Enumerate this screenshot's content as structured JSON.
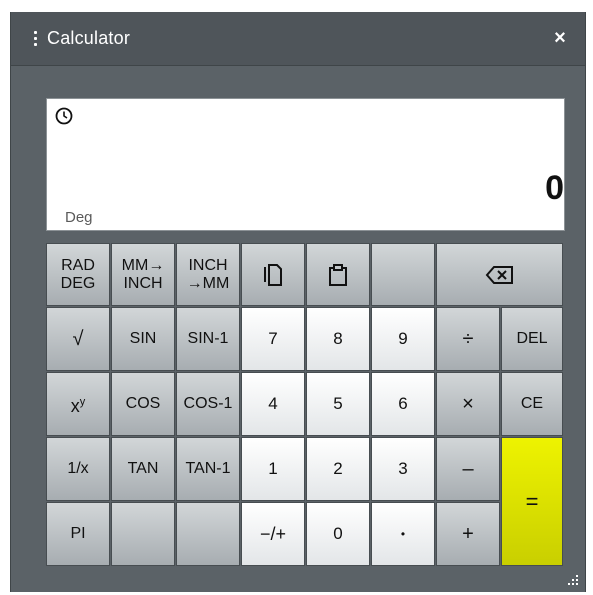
{
  "window": {
    "title": "Calculator",
    "close_glyph": "×"
  },
  "display": {
    "result": "0",
    "angle_mode": "Deg"
  },
  "keys": {
    "rad_deg": {
      "line1": "RAD",
      "line2": "DEG"
    },
    "mm_inch": {
      "line1": "MM→",
      "line2": "INCH"
    },
    "inch_mm": {
      "line1": "INCH",
      "line2": "→MM"
    },
    "copy_icon": "copy-icon",
    "paste_icon": "clipboard-icon",
    "backspace_icon": "backspace-icon",
    "sqrt": "√",
    "sin": "SIN",
    "asin": "SIN-1",
    "x_pow_y": {
      "base": "x",
      "exp": "y"
    },
    "cos": "COS",
    "acos": "COS-1",
    "reciprocal": "1/x",
    "tan": "TAN",
    "atan": "TAN-1",
    "pi": "PI",
    "digits": {
      "d7": "7",
      "d8": "8",
      "d9": "9",
      "d4": "4",
      "d5": "5",
      "d6": "6",
      "d1": "1",
      "d2": "2",
      "d3": "3",
      "d0": "0"
    },
    "negate": "−/+",
    "decimal": "•",
    "divide": "÷",
    "multiply": "×",
    "minus": "–",
    "plus": "+",
    "del": "DEL",
    "ce": "CE",
    "equals": "="
  },
  "colors": {
    "equals_key": "#dfe500",
    "window_bg": "#5b6267",
    "titlebar_bg": "#4f555a"
  }
}
